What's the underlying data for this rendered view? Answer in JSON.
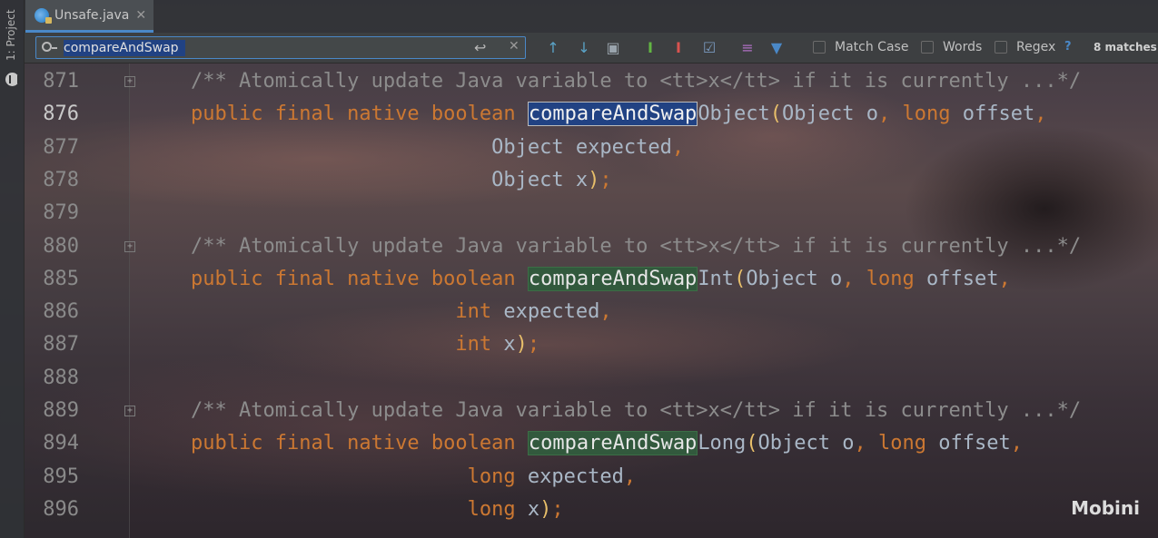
{
  "side_panel": {
    "label": "1: Project",
    "icon": "project-icon"
  },
  "tab": {
    "file_name": "Unsafe.java",
    "close_glyph": "✕",
    "icon": "java-class-icon"
  },
  "search": {
    "query": "compareAndSwap",
    "newline_glyph": "↩",
    "clear_glyph": "✕",
    "buttons": [
      {
        "name": "previous-occurrence-icon",
        "glyph": "↑"
      },
      {
        "name": "next-occurrence-icon",
        "glyph": "↓"
      },
      {
        "name": "show-all-occurrences-icon",
        "glyph": "▣"
      },
      {
        "name": "add-occurrence-icon",
        "glyph": "I"
      },
      {
        "name": "remove-occurrence-icon",
        "glyph": "I"
      },
      {
        "name": "select-all-occurrences-icon",
        "glyph": "☑"
      },
      {
        "name": "filter-icon",
        "glyph": "≡"
      },
      {
        "name": "funnel-icon",
        "glyph": "▼"
      }
    ],
    "options": {
      "match_case": "Match Case",
      "words": "Words",
      "regex": "Regex"
    },
    "help": "?",
    "match_count": "8 matches"
  },
  "editor": {
    "lines": [
      {
        "num": "871",
        "fold": "+",
        "tokens": [
          {
            "t": "/** Atomically update Java variable to <tt>x</tt> if it is currently ...*/",
            "c": "c-com"
          }
        ]
      },
      {
        "num": "876",
        "current": true,
        "tokens": [
          {
            "t": "public final native boolean ",
            "c": "c-kw"
          },
          {
            "t": "compareAndSwap",
            "c": "m-cur"
          },
          {
            "t": "Object",
            "c": "c-id"
          },
          {
            "t": "(",
            "c": "c-paren"
          },
          {
            "t": "Object o",
            "c": "c-id"
          },
          {
            "t": ", ",
            "c": "c-p"
          },
          {
            "t": "long ",
            "c": "c-kw"
          },
          {
            "t": "offset",
            "c": "c-id"
          },
          {
            "t": ",",
            "c": "c-p"
          }
        ]
      },
      {
        "num": "877",
        "indent": "                         ",
        "tokens": [
          {
            "t": "Object expected",
            "c": "c-id"
          },
          {
            "t": ",",
            "c": "c-p"
          }
        ]
      },
      {
        "num": "878",
        "indent": "                         ",
        "tokens": [
          {
            "t": "Object x",
            "c": "c-id"
          },
          {
            "t": ")",
            "c": "c-paren"
          },
          {
            "t": ";",
            "c": "c-p"
          }
        ]
      },
      {
        "num": "879",
        "tokens": []
      },
      {
        "num": "880",
        "fold": "+",
        "tokens": [
          {
            "t": "/** Atomically update Java variable to <tt>x</tt> if it is currently ...*/",
            "c": "c-com"
          }
        ]
      },
      {
        "num": "885",
        "tokens": [
          {
            "t": "public final native boolean ",
            "c": "c-kw"
          },
          {
            "t": "compareAndSwap",
            "c": "m-oth"
          },
          {
            "t": "Int",
            "c": "c-id"
          },
          {
            "t": "(",
            "c": "c-paren"
          },
          {
            "t": "Object o",
            "c": "c-id"
          },
          {
            "t": ", ",
            "c": "c-p"
          },
          {
            "t": "long ",
            "c": "c-kw"
          },
          {
            "t": "offset",
            "c": "c-id"
          },
          {
            "t": ",",
            "c": "c-p"
          }
        ]
      },
      {
        "num": "886",
        "indent": "                      ",
        "tokens": [
          {
            "t": "int ",
            "c": "c-kw"
          },
          {
            "t": "expected",
            "c": "c-id"
          },
          {
            "t": ",",
            "c": "c-p"
          }
        ]
      },
      {
        "num": "887",
        "indent": "                      ",
        "tokens": [
          {
            "t": "int ",
            "c": "c-kw"
          },
          {
            "t": "x",
            "c": "c-id"
          },
          {
            "t": ")",
            "c": "c-paren"
          },
          {
            "t": ";",
            "c": "c-p"
          }
        ]
      },
      {
        "num": "888",
        "tokens": []
      },
      {
        "num": "889",
        "fold": "+",
        "tokens": [
          {
            "t": "/** Atomically update Java variable to <tt>x</tt> if it is currently ...*/",
            "c": "c-com"
          }
        ]
      },
      {
        "num": "894",
        "tokens": [
          {
            "t": "public final native boolean ",
            "c": "c-kw"
          },
          {
            "t": "compareAndSwap",
            "c": "m-oth"
          },
          {
            "t": "Long",
            "c": "c-id"
          },
          {
            "t": "(",
            "c": "c-paren"
          },
          {
            "t": "Object o",
            "c": "c-id"
          },
          {
            "t": ", ",
            "c": "c-p"
          },
          {
            "t": "long ",
            "c": "c-kw"
          },
          {
            "t": "offset",
            "c": "c-id"
          },
          {
            "t": ",",
            "c": "c-p"
          }
        ]
      },
      {
        "num": "895",
        "indent": "                       ",
        "tokens": [
          {
            "t": "long ",
            "c": "c-kw"
          },
          {
            "t": "expected",
            "c": "c-id"
          },
          {
            "t": ",",
            "c": "c-p"
          }
        ]
      },
      {
        "num": "896",
        "indent": "                       ",
        "tokens": [
          {
            "t": "long ",
            "c": "c-kw"
          },
          {
            "t": "x",
            "c": "c-id"
          },
          {
            "t": ")",
            "c": "c-paren"
          },
          {
            "t": ";",
            "c": "c-p"
          }
        ]
      }
    ]
  },
  "watermark": "Mobini",
  "colors": {
    "keyword": "#cc7832",
    "comment": "#8c8c8c",
    "identifier": "#a9b7c6",
    "current_match_bg": "#214283",
    "other_match_bg": "#32593d",
    "accent": "#4a88c7"
  }
}
